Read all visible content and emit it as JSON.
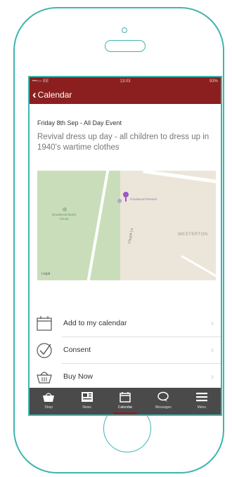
{
  "status_bar": {
    "carrier": "•••○○ EE",
    "time": "13:03",
    "battery": "93%"
  },
  "nav": {
    "back_label": "Calendar"
  },
  "event": {
    "date_line": "Friday 8th Sep - All Day Event",
    "description": "Revival dress up day - all children to dress up in 1940's wartime clothes"
  },
  "map": {
    "label_westerton": "WESTERTON",
    "label_legal": "Legal",
    "label_school": "Goodwood Motor Circuit",
    "label_venue": "Goodwood Revival",
    "label_road": "Claypit La"
  },
  "actions": [
    {
      "label": "Add to my calendar",
      "icon": "calendar-icon"
    },
    {
      "label": "Consent",
      "icon": "checkmark-icon"
    },
    {
      "label": "Buy Now",
      "icon": "basket-icon"
    }
  ],
  "tabs": [
    {
      "label": "Shop",
      "icon": "basket-icon"
    },
    {
      "label": "News",
      "icon": "news-icon"
    },
    {
      "label": "Calendar",
      "icon": "calendar-icon",
      "active": true
    },
    {
      "label": "Messages",
      "icon": "chat-icon"
    },
    {
      "label": "Menu",
      "icon": "menu-icon"
    }
  ],
  "colors": {
    "accent": "#3fb5ae",
    "brand": "#8b1f1f",
    "tabbar": "#4a4a4a"
  }
}
